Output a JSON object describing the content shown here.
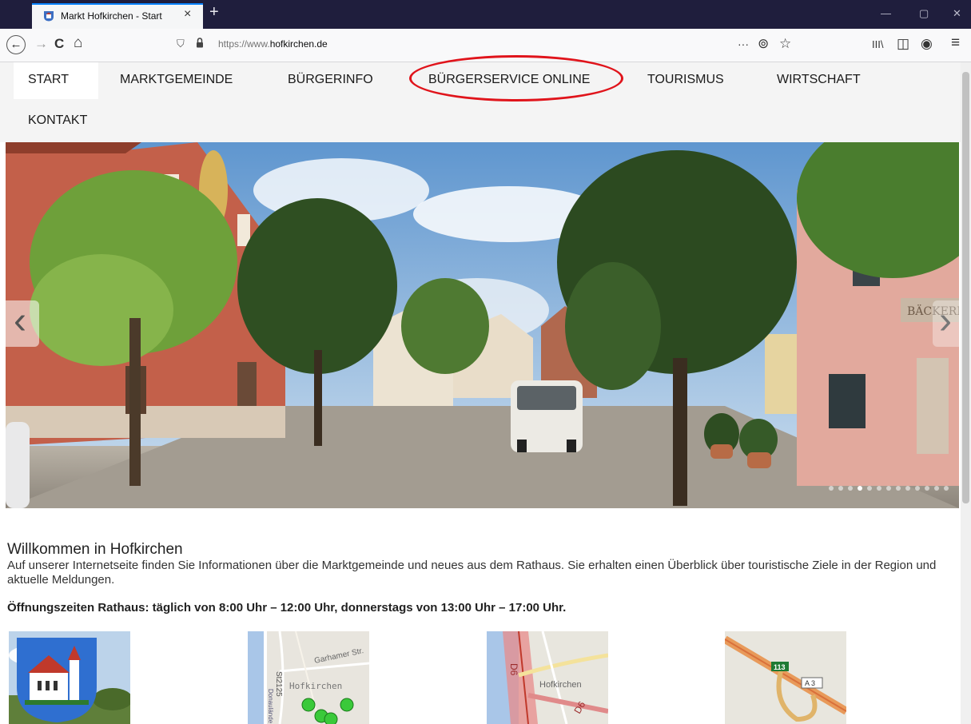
{
  "browser": {
    "tab_title": "Markt Hofkirchen - Start",
    "tab_close": "×",
    "new_tab": "+",
    "url_prefix": "https://www.",
    "url_domain": "hofkirchen.de",
    "back": "←",
    "forward": "→",
    "reload": "C",
    "home": "⌂",
    "shield": "⛉",
    "more": "···",
    "pocket": "⊚",
    "star": "☆",
    "library": "III\\",
    "sidebar": "◫",
    "account": "◉",
    "menu": "≡",
    "minimize": "—",
    "maximize": "▢",
    "close": "✕"
  },
  "nav": {
    "start": "START",
    "marktgemeinde": "MARKTGEMEINDE",
    "buergerinfo": "BÜRGERINFO",
    "buergerservice": "BÜRGERSERVICE ONLINE",
    "tourismus": "TOURISMUS",
    "wirtschaft": "WIRTSCHAFT",
    "kontakt": "KONTAKT"
  },
  "hero": {
    "shop_sign": "BÄCKEREI",
    "prev": "‹",
    "next": "›",
    "slide_count": 13,
    "active_slide": 4
  },
  "content": {
    "welcome_title": "Willkommen in Hofkirchen",
    "welcome_text": "Auf unserer Internetseite finden Sie Informationen über die Marktgemeinde und neues aus dem Rathaus. Sie erhalten einen Überblick über touristische Ziele in der Region und aktuelle Meldungen.",
    "opening_hours": "Öffnungszeiten Rathaus: täglich von 8:00 Uhr – 12:00 Uhr, donnerstags von 13:00 Uhr – 17:00 Uhr."
  },
  "map1": {
    "road": "St2125",
    "street": "Garhamer Str.",
    "river": "Donaulände",
    "town": "Hofkirchen"
  },
  "map2": {
    "road": "D6",
    "road2": "D6",
    "town": "Hofkirchen"
  },
  "map3": {
    "exit": "113",
    "motorway": "A 3"
  },
  "colors": {
    "highlight_circle": "#e0141b",
    "tab_accent": "#0a84ff",
    "tabstrip": "#1f1e3d"
  }
}
